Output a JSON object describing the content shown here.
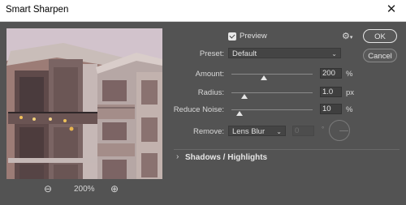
{
  "window": {
    "title": "Smart Sharpen",
    "close_glyph": "✕"
  },
  "preview": {
    "checkbox_label": "Preview",
    "checked": true,
    "zoom": {
      "zoom_out_glyph": "⊖",
      "level": "200%",
      "zoom_in_glyph": "⊕"
    }
  },
  "settings_icon": "gear-icon",
  "buttons": {
    "ok": "OK",
    "cancel": "Cancel"
  },
  "preset": {
    "label": "Preset:",
    "value": "Default"
  },
  "sliders": [
    {
      "id": "amount",
      "label": "Amount:",
      "value": "200",
      "unit": "%",
      "fraction": 0.4
    },
    {
      "id": "radius",
      "label": "Radius:",
      "value": "1.0",
      "unit": "px",
      "fraction": 0.16
    },
    {
      "id": "reduce-noise",
      "label": "Reduce Noise:",
      "value": "10",
      "unit": "%",
      "fraction": 0.1
    }
  ],
  "remove": {
    "label": "Remove:",
    "value": "Lens Blur",
    "angle_value": "0",
    "angle_unit": "°"
  },
  "shadows_highlights": {
    "label": "Shadows / Highlights",
    "expanded": false
  },
  "colors": {
    "dialog_bg": "#535353",
    "field_bg": "#3f3f3f",
    "text": "#e0e0e0"
  }
}
